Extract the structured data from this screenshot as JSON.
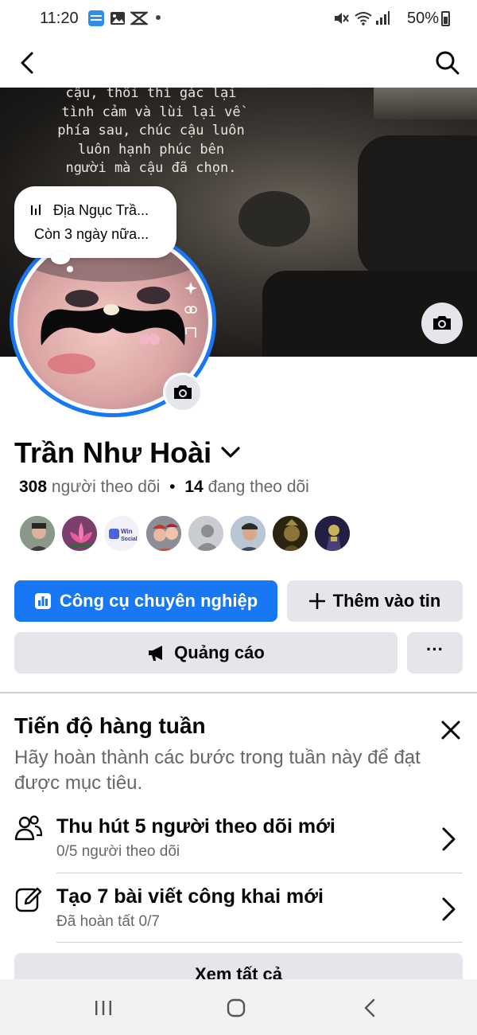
{
  "status_bar": {
    "time": "11:20",
    "battery": "50%",
    "icons": [
      "novel-toon-icon",
      "gallery-icon",
      "capcut-icon",
      "mute-icon",
      "wifi-icon",
      "signal-icon",
      "battery-icon"
    ]
  },
  "cover": {
    "quote_lines": [
      "cậu, thôi thì gác lại",
      "tình cảm và lùi lại về",
      "phía sau, chúc cậu luôn",
      "luôn hạnh phúc bên",
      "người mà cậu đã chọn."
    ]
  },
  "note": {
    "music_title": "Địa Ngục Trầ...",
    "expiry": "Còn 3 ngày nữa..."
  },
  "profile": {
    "name": "Trần Như Hoài",
    "followers_count": "308",
    "followers_label": "người theo dõi",
    "following_count": "14",
    "following_label": "đang theo dõi",
    "separator": "•"
  },
  "friends": [
    {
      "name": "friend-1",
      "color": "#6d7e6a"
    },
    {
      "name": "friend-2",
      "color": "#c5528f"
    },
    {
      "name": "friend-3",
      "color": "#f1eff7"
    },
    {
      "name": "friend-4",
      "color": "#a5625e"
    },
    {
      "name": "friend-5",
      "color": "#c9ccd1"
    },
    {
      "name": "friend-6",
      "color": "#7a8ea3"
    },
    {
      "name": "friend-7",
      "color": "#4f4422"
    },
    {
      "name": "friend-8",
      "color": "#2c2950"
    }
  ],
  "friend_badge": "Win Social",
  "actions": {
    "pro_tools": "Công cụ chuyên nghiệp",
    "add_story": "Thêm vào tin",
    "ads": "Quảng cáo",
    "more": "···"
  },
  "weekly": {
    "title": "Tiến độ hàng tuần",
    "description": "Hãy hoàn thành các bước trong tuần này để đạt được mục tiêu.",
    "tasks": [
      {
        "title": "Thu hút 5 người theo dõi mới",
        "subtitle": "0/5 người theo dõi"
      },
      {
        "title": "Tạo 7 bài viết công khai mới",
        "subtitle": "Đã hoàn tất 0/7"
      }
    ],
    "see_all": "Xem tất cả"
  },
  "colors": {
    "accent": "#1877f2",
    "button_gray": "#e4e6eb",
    "secondary_text": "#65676b"
  }
}
